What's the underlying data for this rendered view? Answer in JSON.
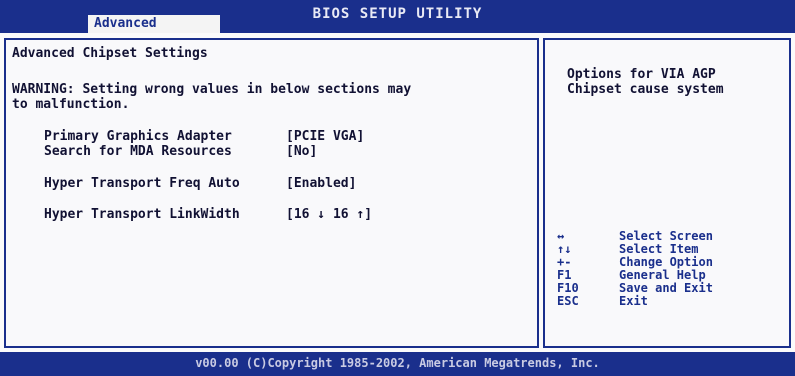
{
  "header": {
    "title": "BIOS SETUP UTILITY",
    "active_tab": "Advanced"
  },
  "main": {
    "heading": "Advanced Chipset Settings",
    "warning_line1": "WARNING: Setting wrong values in below sections may",
    "warning_line2": "to malfunction.",
    "settings": [
      {
        "label": "Primary Graphics Adapter",
        "value": "[PCIE VGA]"
      },
      {
        "label": "Search for MDA Resources",
        "value": "[No]"
      },
      {
        "label": "Hyper Transport Freq Auto",
        "value": "[Enabled]"
      },
      {
        "label": "Hyper Transport LinkWidth",
        "value": "[16 ↓ 16 ↑]"
      }
    ]
  },
  "help": {
    "line1": "Options for VIA AGP",
    "line2": "Chipset cause system"
  },
  "keys": [
    {
      "key": "↔",
      "action": "Select Screen"
    },
    {
      "key": "↑↓",
      "action": "Select Item"
    },
    {
      "key": "+-",
      "action": "Change Option"
    },
    {
      "key": "F1",
      "action": "General Help"
    },
    {
      "key": "F10",
      "action": "Save and Exit"
    },
    {
      "key": "ESC",
      "action": "Exit"
    }
  ],
  "footer": {
    "copyright": "v00.00 (C)Copyright 1985-2002, American Megatrends, Inc."
  }
}
